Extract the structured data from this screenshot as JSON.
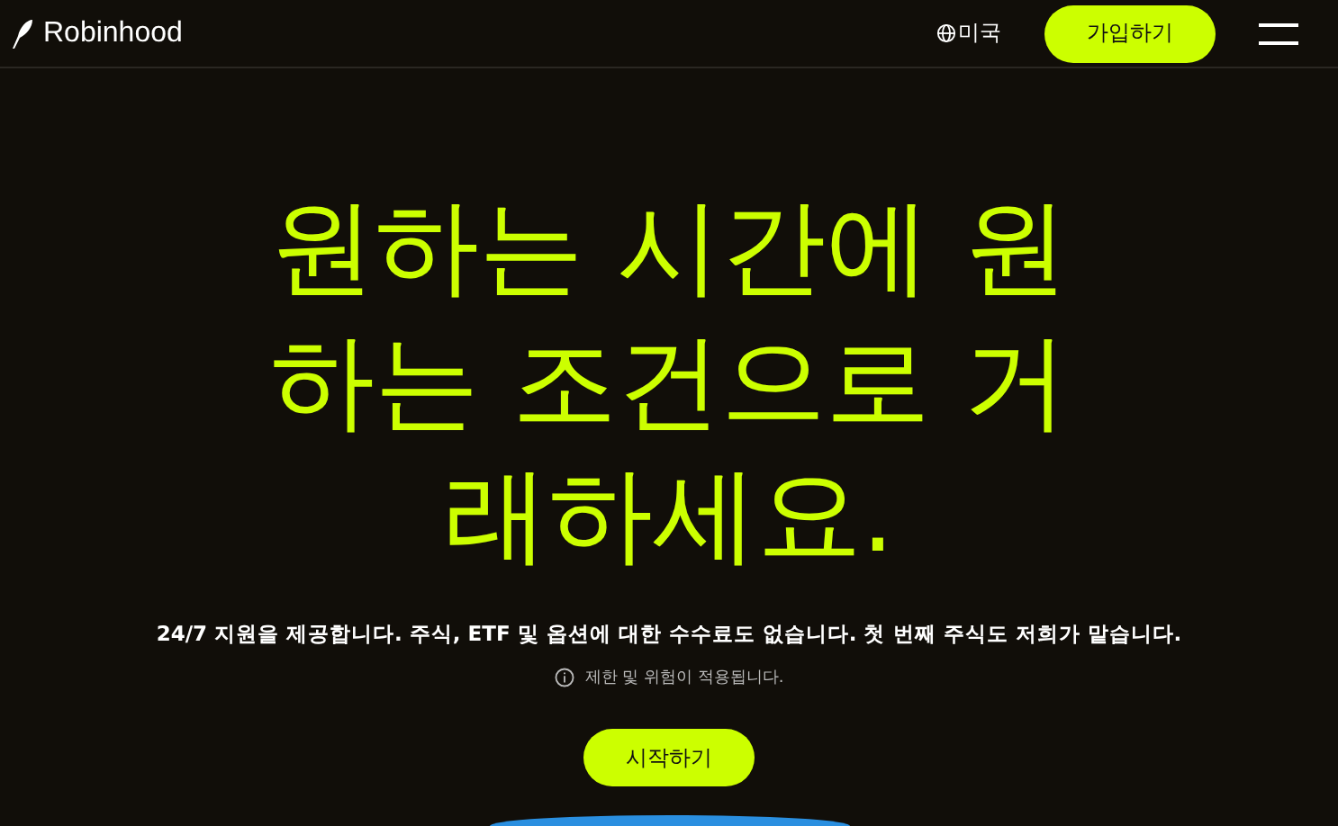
{
  "header": {
    "logo": "Robinhood",
    "region": "미국",
    "signup": "가입하기"
  },
  "hero": {
    "headline": "원하는 시간에 원하는 조건으로 거래하세요.",
    "subtitle": "24/7 지원을 제공합니다. 주식, ETF 및 옵션에 대한 수수료도 없습니다. 첫 번째 주식도 저희가 맡습니다.",
    "disclaimer": "제한 및 위험이 적용됩니다.",
    "cta": "시작하기"
  }
}
